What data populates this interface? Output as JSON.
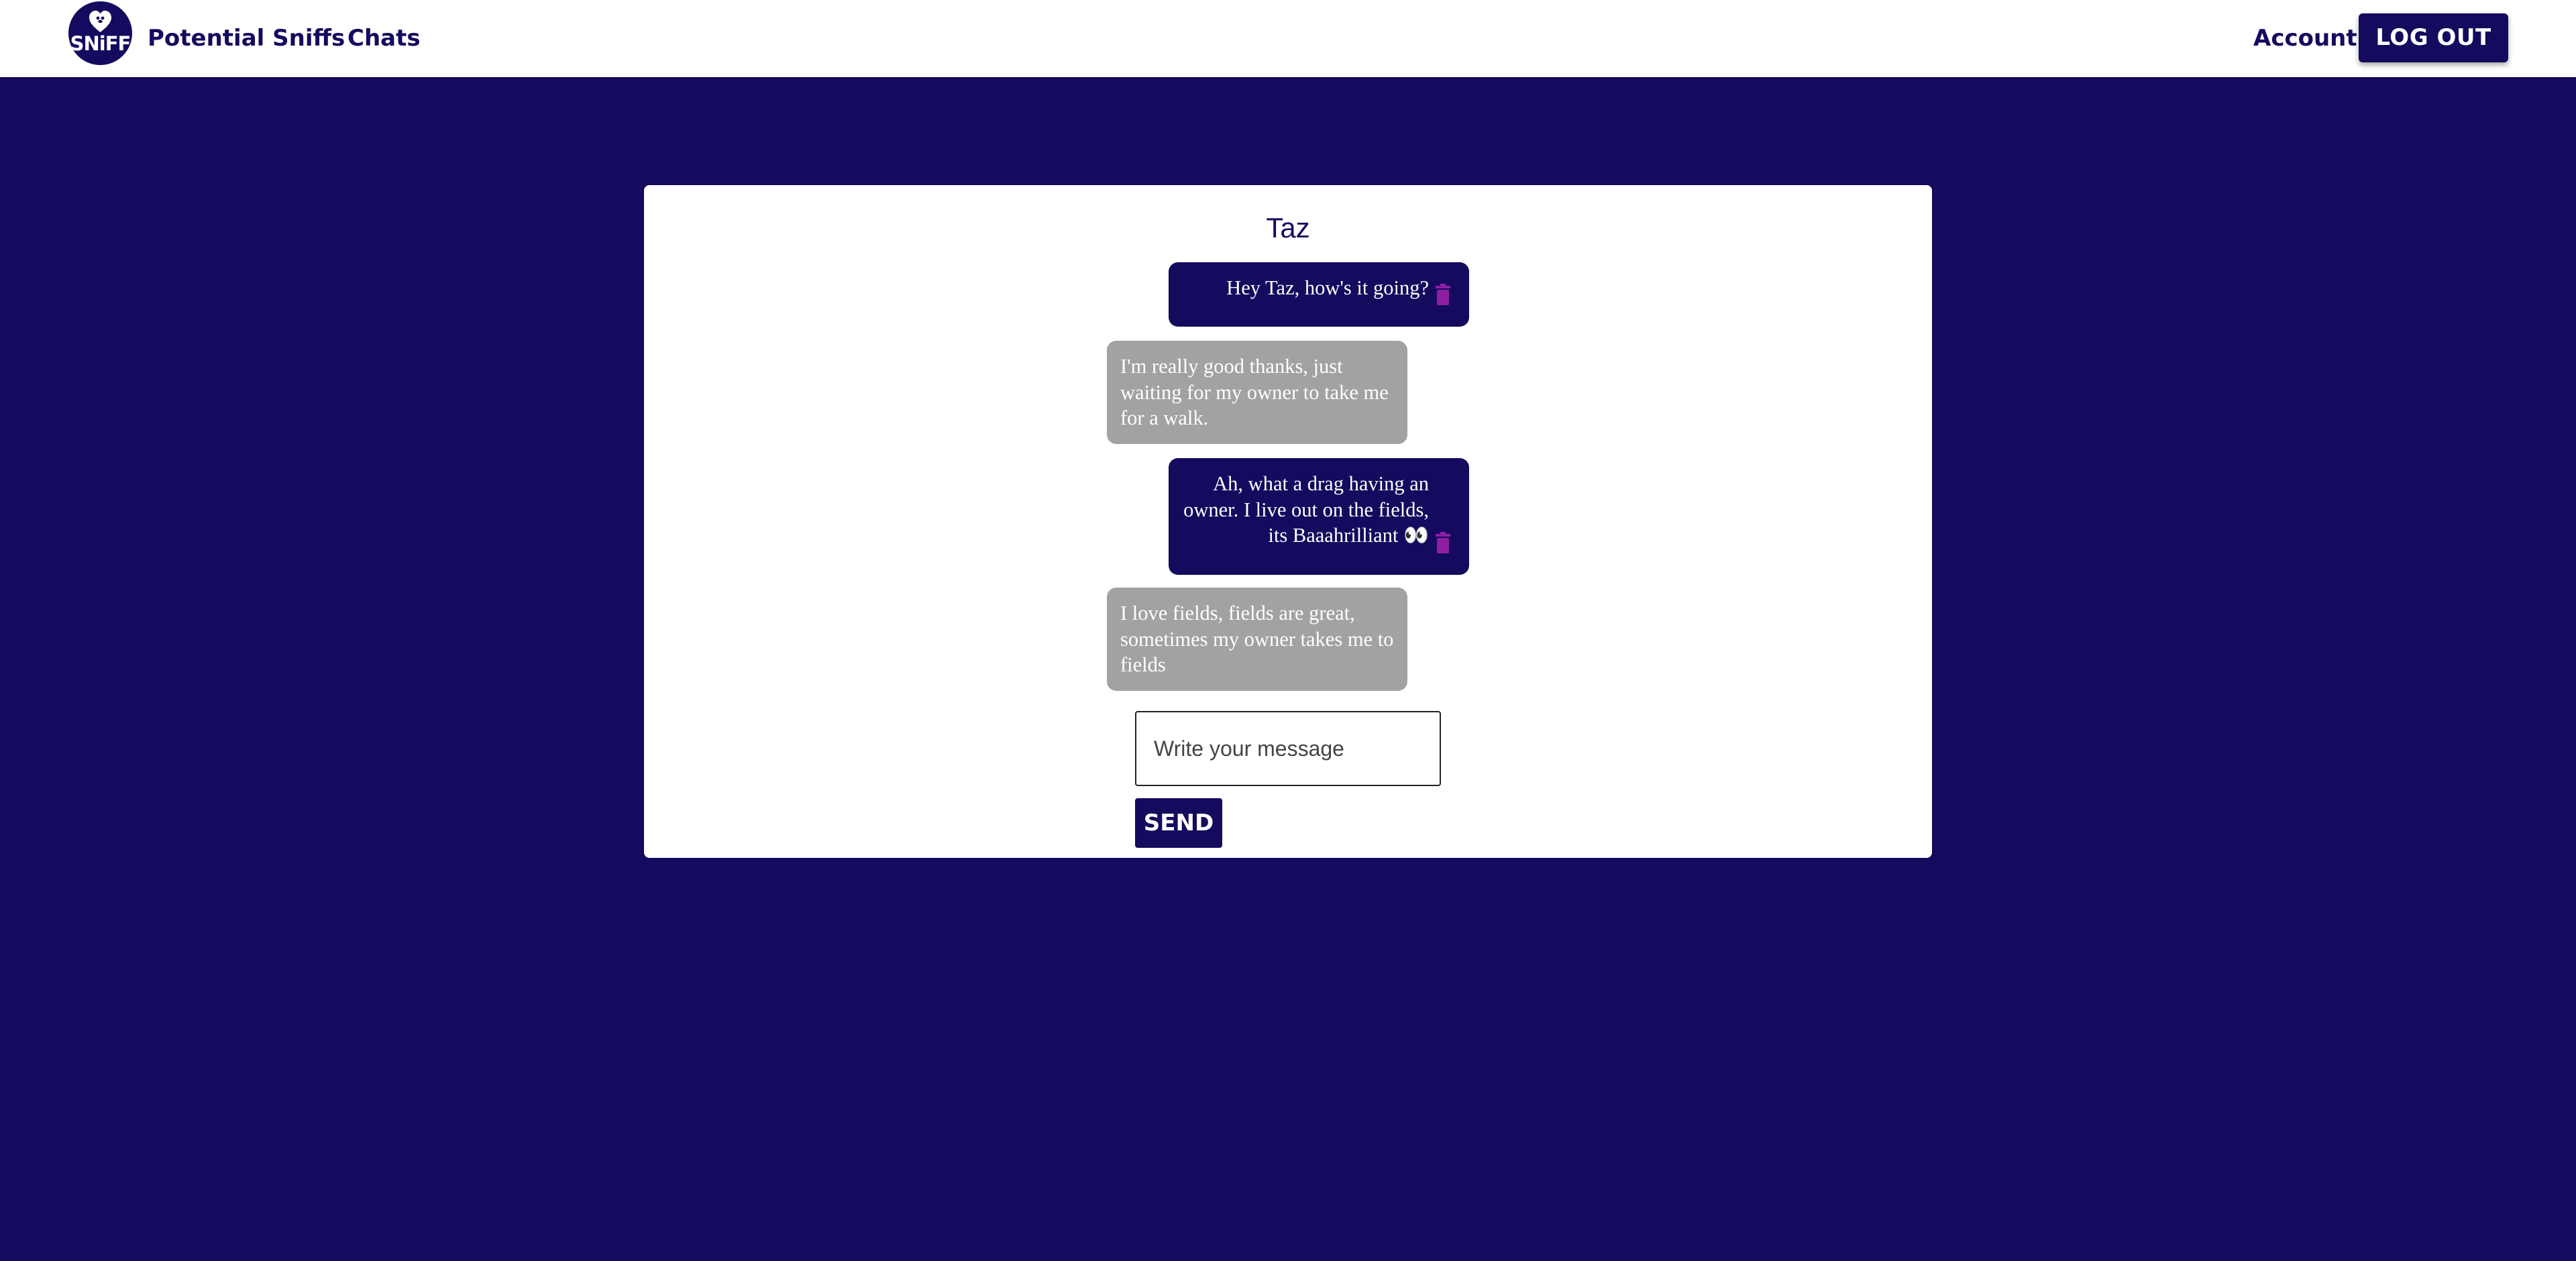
{
  "header": {
    "logo_text": "SNiFF",
    "nav": {
      "potential_sniffs": "Potential Sniffs",
      "chats": "Chats",
      "account": "Account"
    },
    "logout_label": "LOG OUT"
  },
  "chat": {
    "partner_name": "Taz",
    "messages": [
      {
        "direction": "sent",
        "text": "Hey Taz, how's it going?"
      },
      {
        "direction": "received",
        "text": "I'm really good thanks, just waiting for my owner to take me for a walk."
      },
      {
        "direction": "sent",
        "text": "Ah, what a drag having an owner. I live out on the fields, its Baaahrilliant 👀"
      },
      {
        "direction": "received",
        "text": "I love fields, fields are great, sometimes my owner takes me to fields"
      }
    ],
    "input_placeholder": "Write your message",
    "send_label": "SEND"
  },
  "colors": {
    "brand": "#140a5e",
    "received_bubble": "#a2a2a2",
    "trash_icon": "#8e1fa3",
    "card": "#ffffff"
  },
  "icons": {
    "logo": "heart-dog-logo-icon",
    "delete": "trash-icon"
  }
}
